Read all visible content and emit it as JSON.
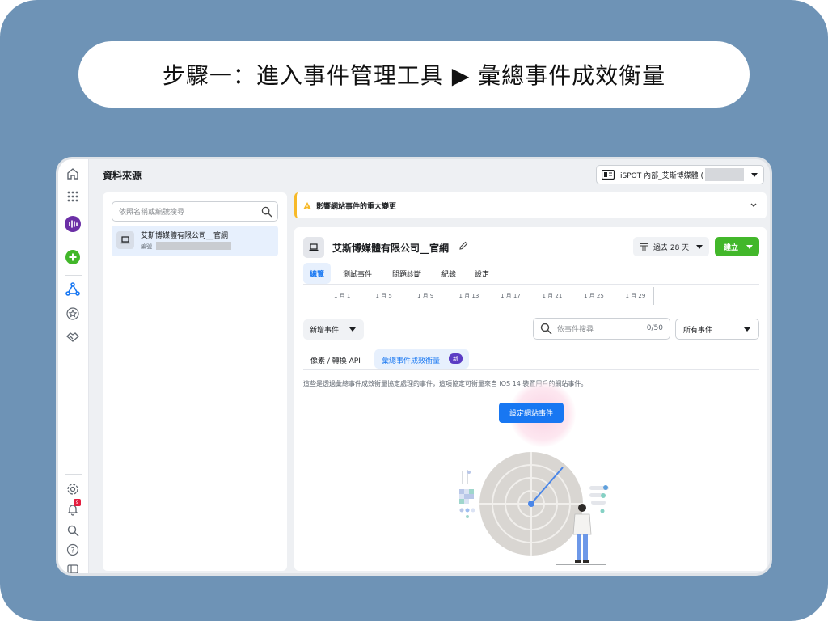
{
  "header": {
    "title": "步驟一：進入事件管理工具 ▶ 彙總事件成效衡量"
  },
  "app": {
    "page_title": "資料來源"
  },
  "account": {
    "label": "iSPOT 內部_艾斯博媒體 ("
  },
  "left_panel": {
    "search_placeholder": "依照名稱或編號搜尋",
    "item": {
      "name": "艾斯博媒體有限公司__官網",
      "id_label": "編號"
    }
  },
  "banner": {
    "text": "影響網站事件的重大變更"
  },
  "pixel": {
    "name": "艾斯博媒體有限公司__官網",
    "date_range": "過去 28 天",
    "create_label": "建立",
    "tabs": [
      "總覽",
      "測試事件",
      "問題診斷",
      "紀錄",
      "設定"
    ],
    "active_tab": 0,
    "timeline_ticks": [
      "1 月 1",
      "1 月 5",
      "1 月 9",
      "1 月 13",
      "1 月 17",
      "1 月 21",
      "1 月 25",
      "1 月 29"
    ]
  },
  "events": {
    "add_event_label": "新增事件",
    "search_placeholder": "依事件搜尋",
    "search_count": "0/50",
    "filter_label": "所有事件",
    "subtabs": [
      "像素 / 轉換 API",
      "彙總事件成效衡量"
    ],
    "new_badge": "新",
    "description": "這些是透過彙總事件成效衡量協定處理的事件，這項協定可衡量來自 iOS 14 裝置用戶的網站事件。",
    "configure_button": "設定網站事件"
  },
  "colors": {
    "accent_blue": "#1877f2",
    "accent_green": "#42b72a",
    "frame_bg": "#6e93b6",
    "badge_purple": "#5b3cc4",
    "warning_yellow": "#f7b928"
  },
  "rail_icons": [
    "home-icon",
    "grid-menu-icon",
    "analytics-icon",
    "add-icon",
    "events-manager-icon",
    "star-icon",
    "handshake-icon",
    "settings-icon",
    "bell-icon",
    "search-icon",
    "help-icon",
    "sidebar-toggle-icon"
  ],
  "notifications": {
    "count": "9"
  }
}
